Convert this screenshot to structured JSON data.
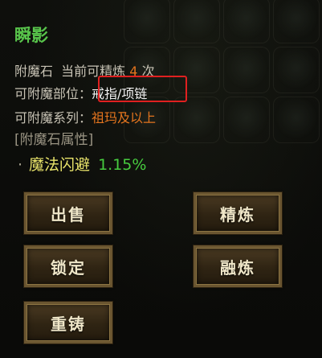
{
  "item": {
    "name": "瞬影"
  },
  "info": {
    "refine_prefix": "附魔石  当前可精炼",
    "refine_count": "4",
    "refine_suffix": "次",
    "slot_label": "可附魔部位：",
    "slot_value": "戒指/项链",
    "series_label": "可附魔系列：",
    "series_value": "祖玛及以上"
  },
  "attributes": {
    "section_title": "[附魔石属性]",
    "items": [
      {
        "bullet": "·",
        "name": "魔法闪避",
        "value": "1.15%"
      }
    ]
  },
  "buttons": {
    "sell": "出售",
    "refine": "精炼",
    "lock": "锁定",
    "fuse": "融炼",
    "recast": "重铸"
  },
  "colors": {
    "title": "#58c44b",
    "count": "#e3741e",
    "series": "#e3741e",
    "attr_name": "#e8e36a",
    "attr_value": "#47cc3f",
    "highlight_box": "#e02020"
  }
}
